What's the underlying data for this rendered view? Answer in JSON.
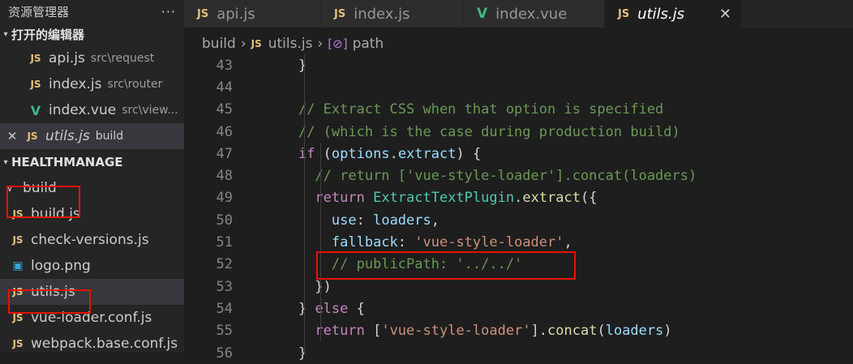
{
  "sidebar": {
    "title": "资源管理器",
    "more": "···",
    "open_editors": {
      "title": "打开的编辑器",
      "items": [
        {
          "icon": "JS",
          "name": "api.js",
          "path": "src\\request"
        },
        {
          "icon": "V",
          "name": "index.js",
          "path": "src\\router"
        },
        {
          "icon": "V",
          "name": "index.vue",
          "path": "src\\view..."
        },
        {
          "icon": "JS",
          "name": "utils.js",
          "path": "build",
          "close": "✕"
        }
      ]
    },
    "project": {
      "title": "HEALTHMANAGE",
      "folder": "build",
      "files": [
        {
          "icon": "JS",
          "name": "build.js"
        },
        {
          "icon": "JS",
          "name": "check-versions.js"
        },
        {
          "icon": "▣",
          "name": "logo.png"
        },
        {
          "icon": "JS",
          "name": "utils.js"
        },
        {
          "icon": "JS",
          "name": "vue-loader.conf.js"
        },
        {
          "icon": "JS",
          "name": "webpack.base.conf.js"
        }
      ]
    }
  },
  "tabs": [
    {
      "icon": "JS",
      "label": "api.js"
    },
    {
      "icon": "JS",
      "label": "index.js"
    },
    {
      "icon": "V",
      "label": "index.vue"
    },
    {
      "icon": "JS",
      "label": "utils.js",
      "close": "✕"
    }
  ],
  "breadcrumbs": {
    "folder": "build",
    "file_icon": "JS",
    "file": "utils.js",
    "symbol_icon": "[⊘]",
    "symbol": "path"
  },
  "code_lines": [
    {
      "n": "43",
      "tokens": [
        [
          "    ",
          "#d4d4d4"
        ],
        [
          "}",
          "#d4d4d4"
        ]
      ]
    },
    {
      "n": "44",
      "tokens": []
    },
    {
      "n": "45",
      "tokens": [
        [
          "    ",
          "#d4d4d4"
        ],
        [
          "// Extract CSS when that option is specified",
          "#6a9955"
        ]
      ]
    },
    {
      "n": "46",
      "tokens": [
        [
          "    ",
          "#d4d4d4"
        ],
        [
          "// (which is the case during production build)",
          "#6a9955"
        ]
      ]
    },
    {
      "n": "47",
      "tokens": [
        [
          "    ",
          "#d4d4d4"
        ],
        [
          "if",
          "#c586c0"
        ],
        [
          " (",
          "#d4d4d4"
        ],
        [
          "options",
          "#9cdcfe"
        ],
        [
          ".",
          "#d4d4d4"
        ],
        [
          "extract",
          "#9cdcfe"
        ],
        [
          ") {",
          "#d4d4d4"
        ]
      ]
    },
    {
      "n": "48",
      "tokens": [
        [
          "      ",
          "#d4d4d4"
        ],
        [
          "// return ['vue-style-loader'].concat(loaders)",
          "#6a9955"
        ]
      ]
    },
    {
      "n": "49",
      "tokens": [
        [
          "      ",
          "#d4d4d4"
        ],
        [
          "return",
          "#c586c0"
        ],
        [
          " ",
          "#d4d4d4"
        ],
        [
          "ExtractTextPlugin",
          "#4ec9b0"
        ],
        [
          ".",
          "#d4d4d4"
        ],
        [
          "extract",
          "#dcdcaa"
        ],
        [
          "({",
          "#d4d4d4"
        ]
      ]
    },
    {
      "n": "50",
      "tokens": [
        [
          "        ",
          "#d4d4d4"
        ],
        [
          "use",
          "#9cdcfe"
        ],
        [
          ": ",
          "#d4d4d4"
        ],
        [
          "loaders",
          "#9cdcfe"
        ],
        [
          ",",
          "#d4d4d4"
        ]
      ]
    },
    {
      "n": "51",
      "tokens": [
        [
          "        ",
          "#d4d4d4"
        ],
        [
          "fallback",
          "#9cdcfe"
        ],
        [
          ": ",
          "#d4d4d4"
        ],
        [
          "'vue-style-loader'",
          "#ce9178"
        ],
        [
          ",",
          "#d4d4d4"
        ]
      ]
    },
    {
      "n": "52",
      "tokens": [
        [
          "        ",
          "#d4d4d4"
        ],
        [
          "// publicPath: '../../'",
          "#6a9955"
        ]
      ]
    },
    {
      "n": "53",
      "tokens": [
        [
          "      ",
          "#d4d4d4"
        ],
        [
          "})",
          "#d4d4d4"
        ]
      ]
    },
    {
      "n": "54",
      "tokens": [
        [
          "    ",
          "#d4d4d4"
        ],
        [
          "} ",
          "#d4d4d4"
        ],
        [
          "else",
          "#c586c0"
        ],
        [
          " {",
          "#d4d4d4"
        ]
      ]
    },
    {
      "n": "55",
      "tokens": [
        [
          "      ",
          "#d4d4d4"
        ],
        [
          "return",
          "#c586c0"
        ],
        [
          " [",
          "#d4d4d4"
        ],
        [
          "'vue-style-loader'",
          "#ce9178"
        ],
        [
          "].",
          "#d4d4d4"
        ],
        [
          "concat",
          "#dcdcaa"
        ],
        [
          "(",
          "#d4d4d4"
        ],
        [
          "loaders",
          "#9cdcfe"
        ],
        [
          ")",
          "#d4d4d4"
        ]
      ]
    },
    {
      "n": "56",
      "tokens": [
        [
          "    ",
          "#d4d4d4"
        ],
        [
          "}",
          "#d4d4d4"
        ]
      ]
    }
  ],
  "colors": {
    "highlight_box": "#e51400",
    "js_icon": "#e5c07b",
    "vue_icon": "#41b883"
  }
}
